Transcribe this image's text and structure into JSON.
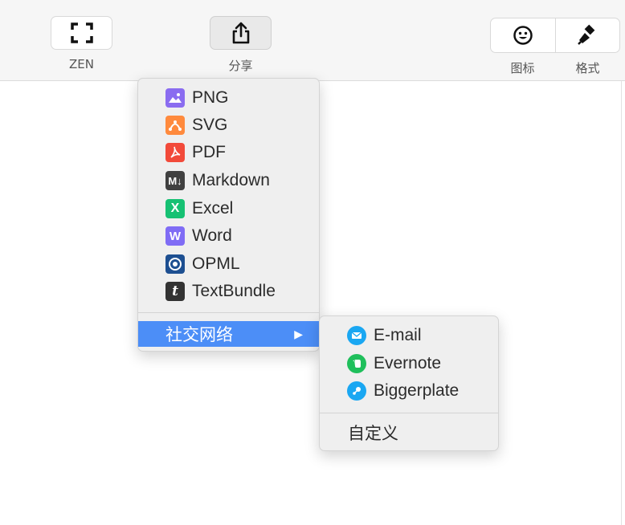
{
  "toolbar": {
    "zen_label": "ZEN",
    "share_label": "分享",
    "icon_label": "图标",
    "format_label": "格式"
  },
  "share_menu": {
    "items": [
      {
        "label": "PNG",
        "icon": "image-icon",
        "color": "#8a6cf0"
      },
      {
        "label": "SVG",
        "icon": "bezier-icon",
        "color": "#ff8a3d"
      },
      {
        "label": "PDF",
        "icon": "pdf-icon",
        "color": "#f24a3a"
      },
      {
        "label": "Markdown",
        "icon": "markdown-icon",
        "color": "#404040"
      },
      {
        "label": "Excel",
        "icon": "excel-icon",
        "color": "#16c173"
      },
      {
        "label": "Word",
        "icon": "word-icon",
        "color": "#7f6cf5"
      },
      {
        "label": "OPML",
        "icon": "opml-icon",
        "color": "#1d4f91"
      },
      {
        "label": "TextBundle",
        "icon": "textbundle-icon",
        "color": "#333333"
      }
    ],
    "social_label": "社交网络",
    "highlight_color": "#4c8ef7"
  },
  "social_menu": {
    "items": [
      {
        "label": "E-mail",
        "icon": "email-icon",
        "color": "#1aa7f2"
      },
      {
        "label": "Evernote",
        "icon": "evernote-icon",
        "color": "#1fbf5b"
      },
      {
        "label": "Biggerplate",
        "icon": "biggerplate-icon",
        "color": "#1aa7f2"
      }
    ],
    "custom_label": "自定义"
  }
}
